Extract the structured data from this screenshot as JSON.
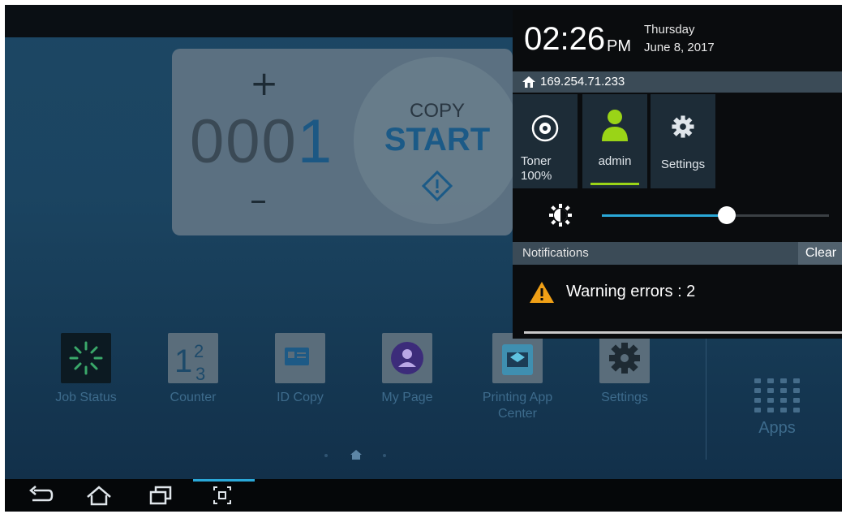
{
  "copy_widget": {
    "plus": "+",
    "minus": "–",
    "count_prefix": "000",
    "count_last": "1",
    "copy_label": "COPY",
    "start_label": "START"
  },
  "apps": [
    {
      "label": "Job Status",
      "icon": "job-status-icon"
    },
    {
      "label": "Counter",
      "icon": "counter-icon"
    },
    {
      "label": "ID Copy",
      "icon": "id-copy-icon"
    },
    {
      "label": "My Page",
      "icon": "my-page-icon"
    },
    {
      "label": "Printing App Center",
      "icon": "printing-app-center-icon"
    },
    {
      "label": "Settings",
      "icon": "settings-icon"
    }
  ],
  "apps_button": {
    "label": "Apps"
  },
  "panel": {
    "time": "02:26",
    "ampm": "PM",
    "weekday": "Thursday",
    "date": "June 8, 2017",
    "ip": "169.254.71.233",
    "tiles": {
      "toner_line1": "Toner",
      "toner_line2": "100%",
      "admin": "admin",
      "settings": "Settings"
    },
    "brightness": 0.55,
    "notifications_title": "Notifications",
    "clear_label": "Clear",
    "warning": "Warning errors : 2"
  },
  "colors": {
    "accent": "#2aa8d8",
    "admin_green": "#9ad417",
    "warning": "#f0a016",
    "start_blue": "#1c5c8a"
  }
}
